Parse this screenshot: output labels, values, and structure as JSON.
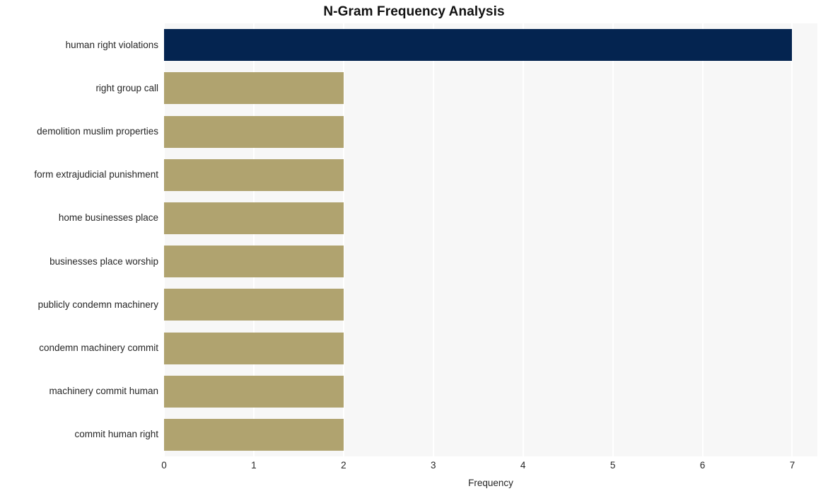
{
  "chart_data": {
    "type": "bar",
    "orientation": "horizontal",
    "title": "N-Gram Frequency Analysis",
    "xlabel": "Frequency",
    "ylabel": "",
    "categories": [
      "human right violations",
      "right group call",
      "demolition muslim properties",
      "form extrajudicial punishment",
      "home businesses place",
      "businesses place worship",
      "publicly condemn machinery",
      "condemn machinery commit",
      "machinery commit human",
      "commit human right"
    ],
    "values": [
      7,
      2,
      2,
      2,
      2,
      2,
      2,
      2,
      2,
      2
    ],
    "xlim": [
      0,
      7.28
    ],
    "xticks": [
      "0",
      "1",
      "2",
      "3",
      "4",
      "5",
      "6",
      "7"
    ],
    "xtick_values": [
      0,
      1,
      2,
      3,
      4,
      5,
      6,
      7
    ],
    "grid": "vertical",
    "legend": "none",
    "bar_colors": [
      "#042450",
      "#b0a36f",
      "#b0a36f",
      "#b0a36f",
      "#b0a36f",
      "#b0a36f",
      "#b0a36f",
      "#b0a36f",
      "#b0a36f",
      "#b0a36f"
    ]
  },
  "style": {
    "figure_background": "#ffffff",
    "plot_background": "#f7f7f7",
    "gridline_color": "#ffffff",
    "text_color": "#262626",
    "title_color": "#111111",
    "highlight_color": "#042450",
    "bar_color": "#b0a36f"
  }
}
